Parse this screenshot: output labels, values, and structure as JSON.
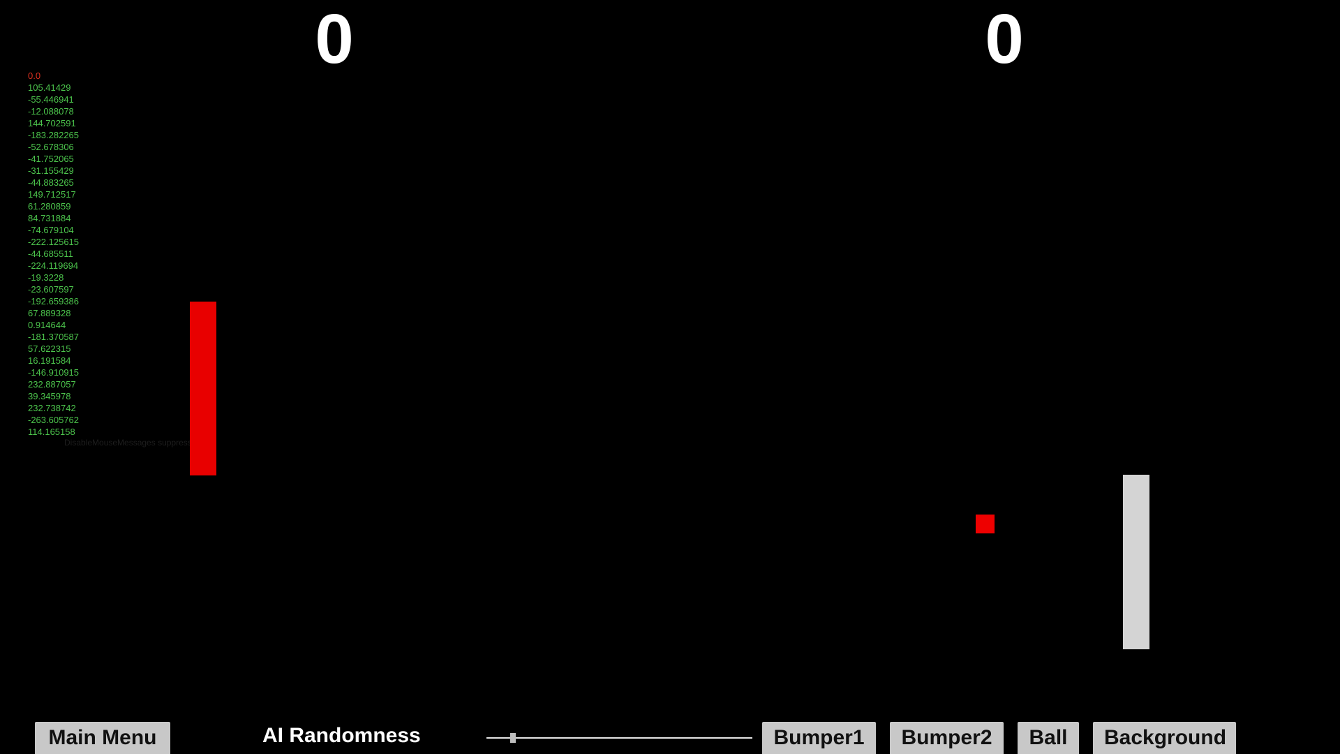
{
  "scores": {
    "left": "0",
    "right": "0"
  },
  "debug_log": [
    "0.0",
    "105.41429",
    "-55.446941",
    "-12.088078",
    "144.702591",
    "-183.282265",
    "-52.678306",
    "-41.752065",
    "-31.155429",
    "-44.883265",
    "149.712517",
    "61.280859",
    "84.731884",
    "-74.679104",
    "-222.125615",
    "-44.685511",
    "-224.119694",
    "-19.3228",
    "-23.607597",
    "-192.659386",
    "67.889328",
    "0.914644",
    "-181.370587",
    "57.622315",
    "16.191584",
    "-146.910915",
    "232.887057",
    "39.345978",
    "232.738742",
    "-263.605762",
    "114.165158"
  ],
  "debug_note": "DisableMouseMessages suppress",
  "controls": {
    "main_menu_label": "Main Menu",
    "ai_randomness_label": "AI Randomness",
    "ai_randomness_value": 0.1,
    "bumper1_label": "Bumper1",
    "bumper2_label": "Bumper2",
    "ball_label": "Ball",
    "background_label": "Background"
  },
  "colors": {
    "background": "#000000",
    "left_paddle": "#e80000",
    "right_paddle": "#d4d4d4",
    "ball": "#ee0000",
    "debug_text": "#4cc44c",
    "debug_first": "#e03020"
  }
}
